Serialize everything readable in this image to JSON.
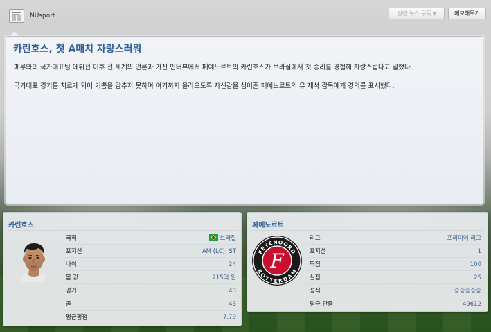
{
  "header": {
    "source": "NUsport",
    "subscribe_label": "관련 뉴스 구독",
    "memo_label": "메모해두기"
  },
  "article": {
    "title": "카린호스, 첫 A매치 자랑스러워",
    "paragraphs": [
      "페루와의 국가대표팀 데뷔전 이후 전 세계의 언론과 가진 인터뷰에서 페예노르트의 카린호스가 브라질에서 첫 승리를 경험해 자랑스럽다고 말했다.",
      "국가대표 경기를 치르게 되어 기쁨을 감추지 못하며 여기까지 올라오도록 자신감을 심어준 페예노르트의 유 재석 감독에게 경의를 표시했다."
    ]
  },
  "player": {
    "name": "카린호스",
    "rows": [
      {
        "label": "국적",
        "value": "브라질"
      },
      {
        "label": "포지션",
        "value": "AM (LC), ST"
      },
      {
        "label": "나이",
        "value": "24"
      },
      {
        "label": "몸 값",
        "value": "215억 원"
      },
      {
        "label": "경기",
        "value": "43"
      },
      {
        "label": "골",
        "value": "43"
      },
      {
        "label": "평균평점",
        "value": "7.79"
      }
    ]
  },
  "club": {
    "name": "페예노르트",
    "crest_text_top": "FEYENOORD",
    "crest_text_bottom": "ROTTERDAM",
    "crest_letter": "F",
    "rows": [
      {
        "label": "리그",
        "value": "프리미어 리그"
      },
      {
        "label": "포지션",
        "value": "1"
      },
      {
        "label": "득점",
        "value": "100"
      },
      {
        "label": "실점",
        "value": "25"
      },
      {
        "label": "성적",
        "value": "승승승승승"
      },
      {
        "label": "평균 관중",
        "value": "49612"
      }
    ]
  },
  "colors": {
    "accent": "#2f5f96",
    "value_text": "#3d5f8e",
    "crest_red": "#c8102e"
  }
}
